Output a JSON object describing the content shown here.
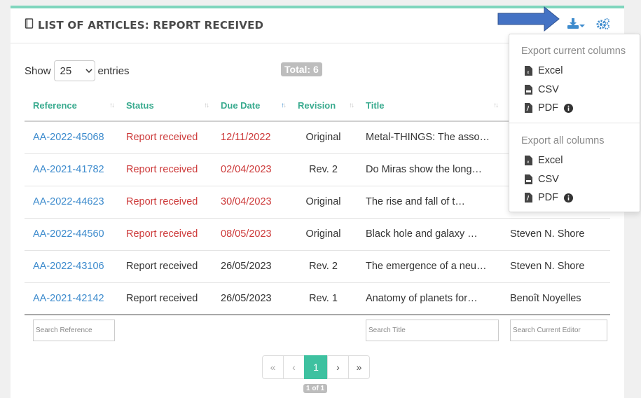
{
  "header": {
    "title": "LIST OF ARTICLES: REPORT RECEIVED"
  },
  "controls": {
    "show_label": "Show",
    "page_size": "25",
    "entries_label": "entries",
    "total": "Total: 6"
  },
  "columns": [
    "Reference",
    "Status",
    "Due Date",
    "Revision",
    "Title"
  ],
  "rows": [
    {
      "ref": "AA-2022-45068",
      "status": "Report received",
      "due": "12/11/2022",
      "revision": "Original",
      "title": "Metal-THINGS: The asso…",
      "editor": ""
    },
    {
      "ref": "AA-2021-41782",
      "status": "Report received",
      "due": "02/04/2023",
      "revision": "Rev. 2",
      "title": "Do Miras show the long…",
      "editor": ""
    },
    {
      "ref": "AA-2022-44623",
      "status": "Report received",
      "due": "30/04/2023",
      "revision": "Original",
      "title": "The rise and fall of t…",
      "editor": ""
    },
    {
      "ref": "AA-2022-44560",
      "status": "Report received",
      "due": "08/05/2023",
      "revision": "Original",
      "title": "Black hole and galaxy …",
      "editor": "Steven N. Shore"
    },
    {
      "ref": "AA-2022-43106",
      "status": "Report received",
      "due": "26/05/2023",
      "revision": "Rev. 2",
      "title": "The emergence of a neu…",
      "editor": "Steven N. Shore"
    },
    {
      "ref": "AA-2021-42142",
      "status": "Report received",
      "due": "26/05/2023",
      "revision": "Rev. 1",
      "title": "Anatomy of planets for…",
      "editor": "Benoît Noyelles"
    }
  ],
  "search": {
    "reference": "Search Reference",
    "title": "Search Title",
    "editor": "Search Current Editor"
  },
  "pagination": {
    "first": "«",
    "prev": "‹",
    "current": "1",
    "next": "›",
    "last": "»",
    "info": "1 of 1"
  },
  "export_menu": {
    "current_heading": "Export current columns",
    "all_heading": "Export all columns",
    "excel": "Excel",
    "csv": "CSV",
    "pdf": "PDF"
  },
  "colors": {
    "accent": "#3ec1a0",
    "link": "#3d8bcd",
    "late": "#cd3a3a",
    "annotation_arrow": "#4472c4"
  },
  "icons": [
    "book-icon",
    "download-icon",
    "cogs-icon",
    "excel-file-icon",
    "csv-file-icon",
    "pdf-file-icon",
    "info-icon",
    "sort-icon"
  ]
}
